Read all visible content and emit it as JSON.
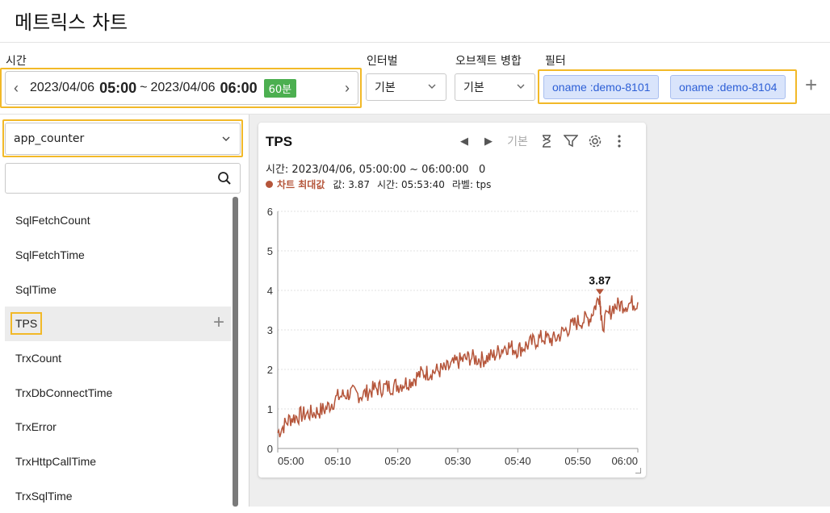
{
  "page_title": "메트릭스 차트",
  "time": {
    "label": "시간",
    "start_date": "2023/04/06",
    "start_time": "05:00",
    "separator": "~",
    "end_date": "2023/04/06",
    "end_time": "06:00",
    "duration_badge": "60분"
  },
  "interval": {
    "label": "인터벌",
    "value": "기본"
  },
  "object_merge": {
    "label": "오브젝트 병합",
    "value": "기본"
  },
  "filter": {
    "label": "필터",
    "chips": [
      "oname :demo-8101",
      "oname :demo-8104"
    ]
  },
  "category": {
    "value": "app_counter"
  },
  "search": {
    "placeholder": ""
  },
  "metrics": [
    "SqlFetchCount",
    "SqlFetchTime",
    "SqlTime",
    "TPS",
    "TrxCount",
    "TrxDbConnectTime",
    "TrxError",
    "TrxHttpCallTime",
    "TrxSqlTime"
  ],
  "selected_metric": "TPS",
  "card": {
    "title": "TPS",
    "interval_text": "기본",
    "info_line": "시간: 2023/04/06, 05:00:00 ~ 06:00:00   0",
    "max_label": "차트 최대값",
    "max_value_text": "값: 3.87",
    "max_time_text": "시간: 05:53:40",
    "max_series_text": "라벨: tps"
  },
  "colors": {
    "series": "#b5553a",
    "highlight": "#f2b928",
    "badge": "#4caf50",
    "chip_bg": "#d9e4fb",
    "chip_text": "#2d5fd6"
  },
  "chart_data": {
    "type": "line",
    "series": [
      {
        "name": "tps",
        "x": [
          "05:00",
          "05:02",
          "05:04",
          "05:06",
          "05:08",
          "05:10",
          "05:12",
          "05:14",
          "05:16",
          "05:18",
          "05:20",
          "05:22",
          "05:24",
          "05:26",
          "05:28",
          "05:30",
          "05:32",
          "05:34",
          "05:36",
          "05:38",
          "05:40",
          "05:42",
          "05:44",
          "05:46",
          "05:48",
          "05:50",
          "05:52",
          "05:53:40",
          "05:54",
          "05:56",
          "05:58",
          "06:00"
        ],
        "values": [
          0.4,
          0.75,
          0.85,
          0.9,
          1.0,
          1.3,
          1.4,
          1.35,
          1.5,
          1.55,
          1.6,
          1.7,
          1.9,
          1.95,
          2.0,
          2.2,
          2.3,
          2.25,
          2.35,
          2.6,
          2.5,
          2.65,
          2.8,
          2.75,
          3.0,
          3.2,
          3.3,
          3.87,
          3.1,
          3.6,
          3.65,
          3.7
        ]
      }
    ],
    "x_ticks": [
      "05:00",
      "05:10",
      "05:20",
      "05:30",
      "05:40",
      "05:50",
      "06:00"
    ],
    "y_ticks": [
      "0",
      "1",
      "2",
      "3",
      "4",
      "5",
      "6"
    ],
    "ylim": [
      0,
      6
    ],
    "max_annotation": {
      "value": "3.87",
      "x": "05:53:40"
    },
    "grid": true,
    "legend": "none"
  }
}
